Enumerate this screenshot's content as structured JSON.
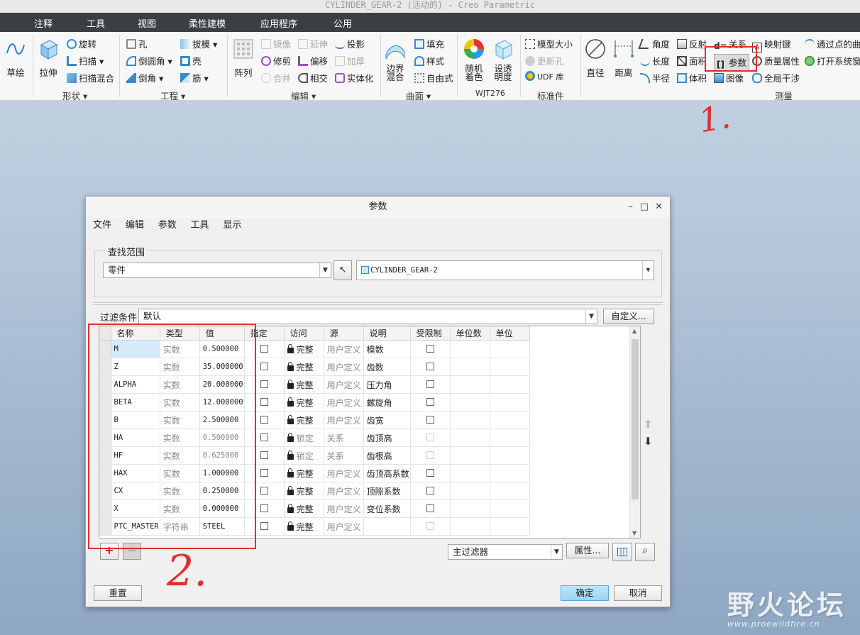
{
  "window": {
    "title": "CYLINDER_GEAR-2 (活动的) - Creo Parametric"
  },
  "menu_tabs": [
    "注释",
    "工具",
    "视图",
    "柔性建模",
    "应用程序",
    "公用"
  ],
  "ribbon": {
    "sketch": "草绘",
    "extrude": "拉伸",
    "revolve": "旋转",
    "sweep": "扫描",
    "swept_blend": "扫描混合",
    "group_shape": "形状",
    "hole": "孔",
    "round": "倒圆角",
    "chamfer": "倒角",
    "draft": "拔模",
    "shell": "壳",
    "rib": "筋",
    "group_engineering": "工程",
    "pattern": "阵列",
    "mirror": "镜像",
    "trim": "修剪",
    "merge": "合并",
    "extend": "延伸",
    "offset": "偏移",
    "intersect": "相交",
    "project": "投影",
    "thicken": "加厚",
    "solidify": "实体化",
    "group_editing": "编辑",
    "boundary_blend": "边界混合",
    "fill": "填充",
    "style": "样式",
    "freestyle": "自由式",
    "group_surfaces": "曲面",
    "random_color": "随机着色",
    "set_transparency": "设透明度",
    "group_wjt": "WJT276",
    "model_size": "模型大小",
    "update_hole": "更新孔",
    "udf_library": "UDF 库",
    "group_standard": "标准件",
    "diameter": "直径",
    "distance": "距离",
    "angle": "角度",
    "length": "长度",
    "radius": "半径",
    "reflect": "反射",
    "area": "面积",
    "volume": "体积",
    "relations": "关系",
    "parameters": "参数",
    "image": "图像",
    "map_key": "映射键",
    "mass_props": "质量属性",
    "global_interference": "全局干涉",
    "curve_through_points": "通过点的曲",
    "open_system": "打开系统窗",
    "group_measure": "测量"
  },
  "annotations": {
    "one": "1.",
    "two": "2."
  },
  "dialog": {
    "title": "参数",
    "menu": [
      "文件",
      "编辑",
      "参数",
      "工具",
      "显示"
    ],
    "lookup_scope_label": "查找范围",
    "scope_value": "零件",
    "model_value": "CYLINDER_GEAR-2",
    "filter_label": "过滤条件",
    "filter_value": "默认",
    "customize_button": "自定义...",
    "columns": [
      "名称",
      "类型",
      "值",
      "指定",
      "访问",
      "源",
      "说明",
      "受限制",
      "单位数",
      "单位"
    ],
    "rows": [
      {
        "name": "M",
        "type": "实数",
        "value": "0.500000",
        "access": "完整",
        "source": "用户定义",
        "desc": "模数",
        "locked": false
      },
      {
        "name": "Z",
        "type": "实数",
        "value": "35.000000",
        "access": "完整",
        "source": "用户定义",
        "desc": "齿数",
        "locked": false
      },
      {
        "name": "ALPHA",
        "type": "实数",
        "value": "20.000000",
        "access": "完整",
        "source": "用户定义",
        "desc": "压力角",
        "locked": false
      },
      {
        "name": "BETA",
        "type": "实数",
        "value": "12.000000",
        "access": "完整",
        "source": "用户定义",
        "desc": "螺旋角",
        "locked": false
      },
      {
        "name": "B",
        "type": "实数",
        "value": "2.500000",
        "access": "完整",
        "source": "用户定义",
        "desc": "齿宽",
        "locked": false
      },
      {
        "name": "HA",
        "type": "实数",
        "value": "0.500000",
        "access": "锁定",
        "source": "关系",
        "desc": "齿顶高",
        "locked": true
      },
      {
        "name": "HF",
        "type": "实数",
        "value": "0.625000",
        "access": "锁定",
        "source": "关系",
        "desc": "齿根高",
        "locked": true
      },
      {
        "name": "HAX",
        "type": "实数",
        "value": "1.000000",
        "access": "完整",
        "source": "用户定义",
        "desc": "齿顶高系数",
        "locked": false
      },
      {
        "name": "CX",
        "type": "实数",
        "value": "0.250000",
        "access": "完整",
        "source": "用户定义",
        "desc": "顶隙系数",
        "locked": false
      },
      {
        "name": "X",
        "type": "实数",
        "value": "0.000000",
        "access": "完整",
        "source": "用户定义",
        "desc": "变位系数",
        "locked": false
      },
      {
        "name": "PTC_MASTER",
        "type": "字符串",
        "value": "STEEL",
        "access": "完整",
        "source": "用户定义",
        "desc": "",
        "locked": false
      }
    ],
    "main_filter": "主过滤器",
    "properties_button": "属性...",
    "reset_button": "重置",
    "ok_button": "确定",
    "cancel_button": "取消"
  },
  "watermark": {
    "text": "野火论坛",
    "url": "www.proewildfire.cn"
  },
  "colors": {
    "highlight": "#e0302d",
    "ribbon_dark": "#3a3f44",
    "primary_button": "#9bd3f3"
  }
}
